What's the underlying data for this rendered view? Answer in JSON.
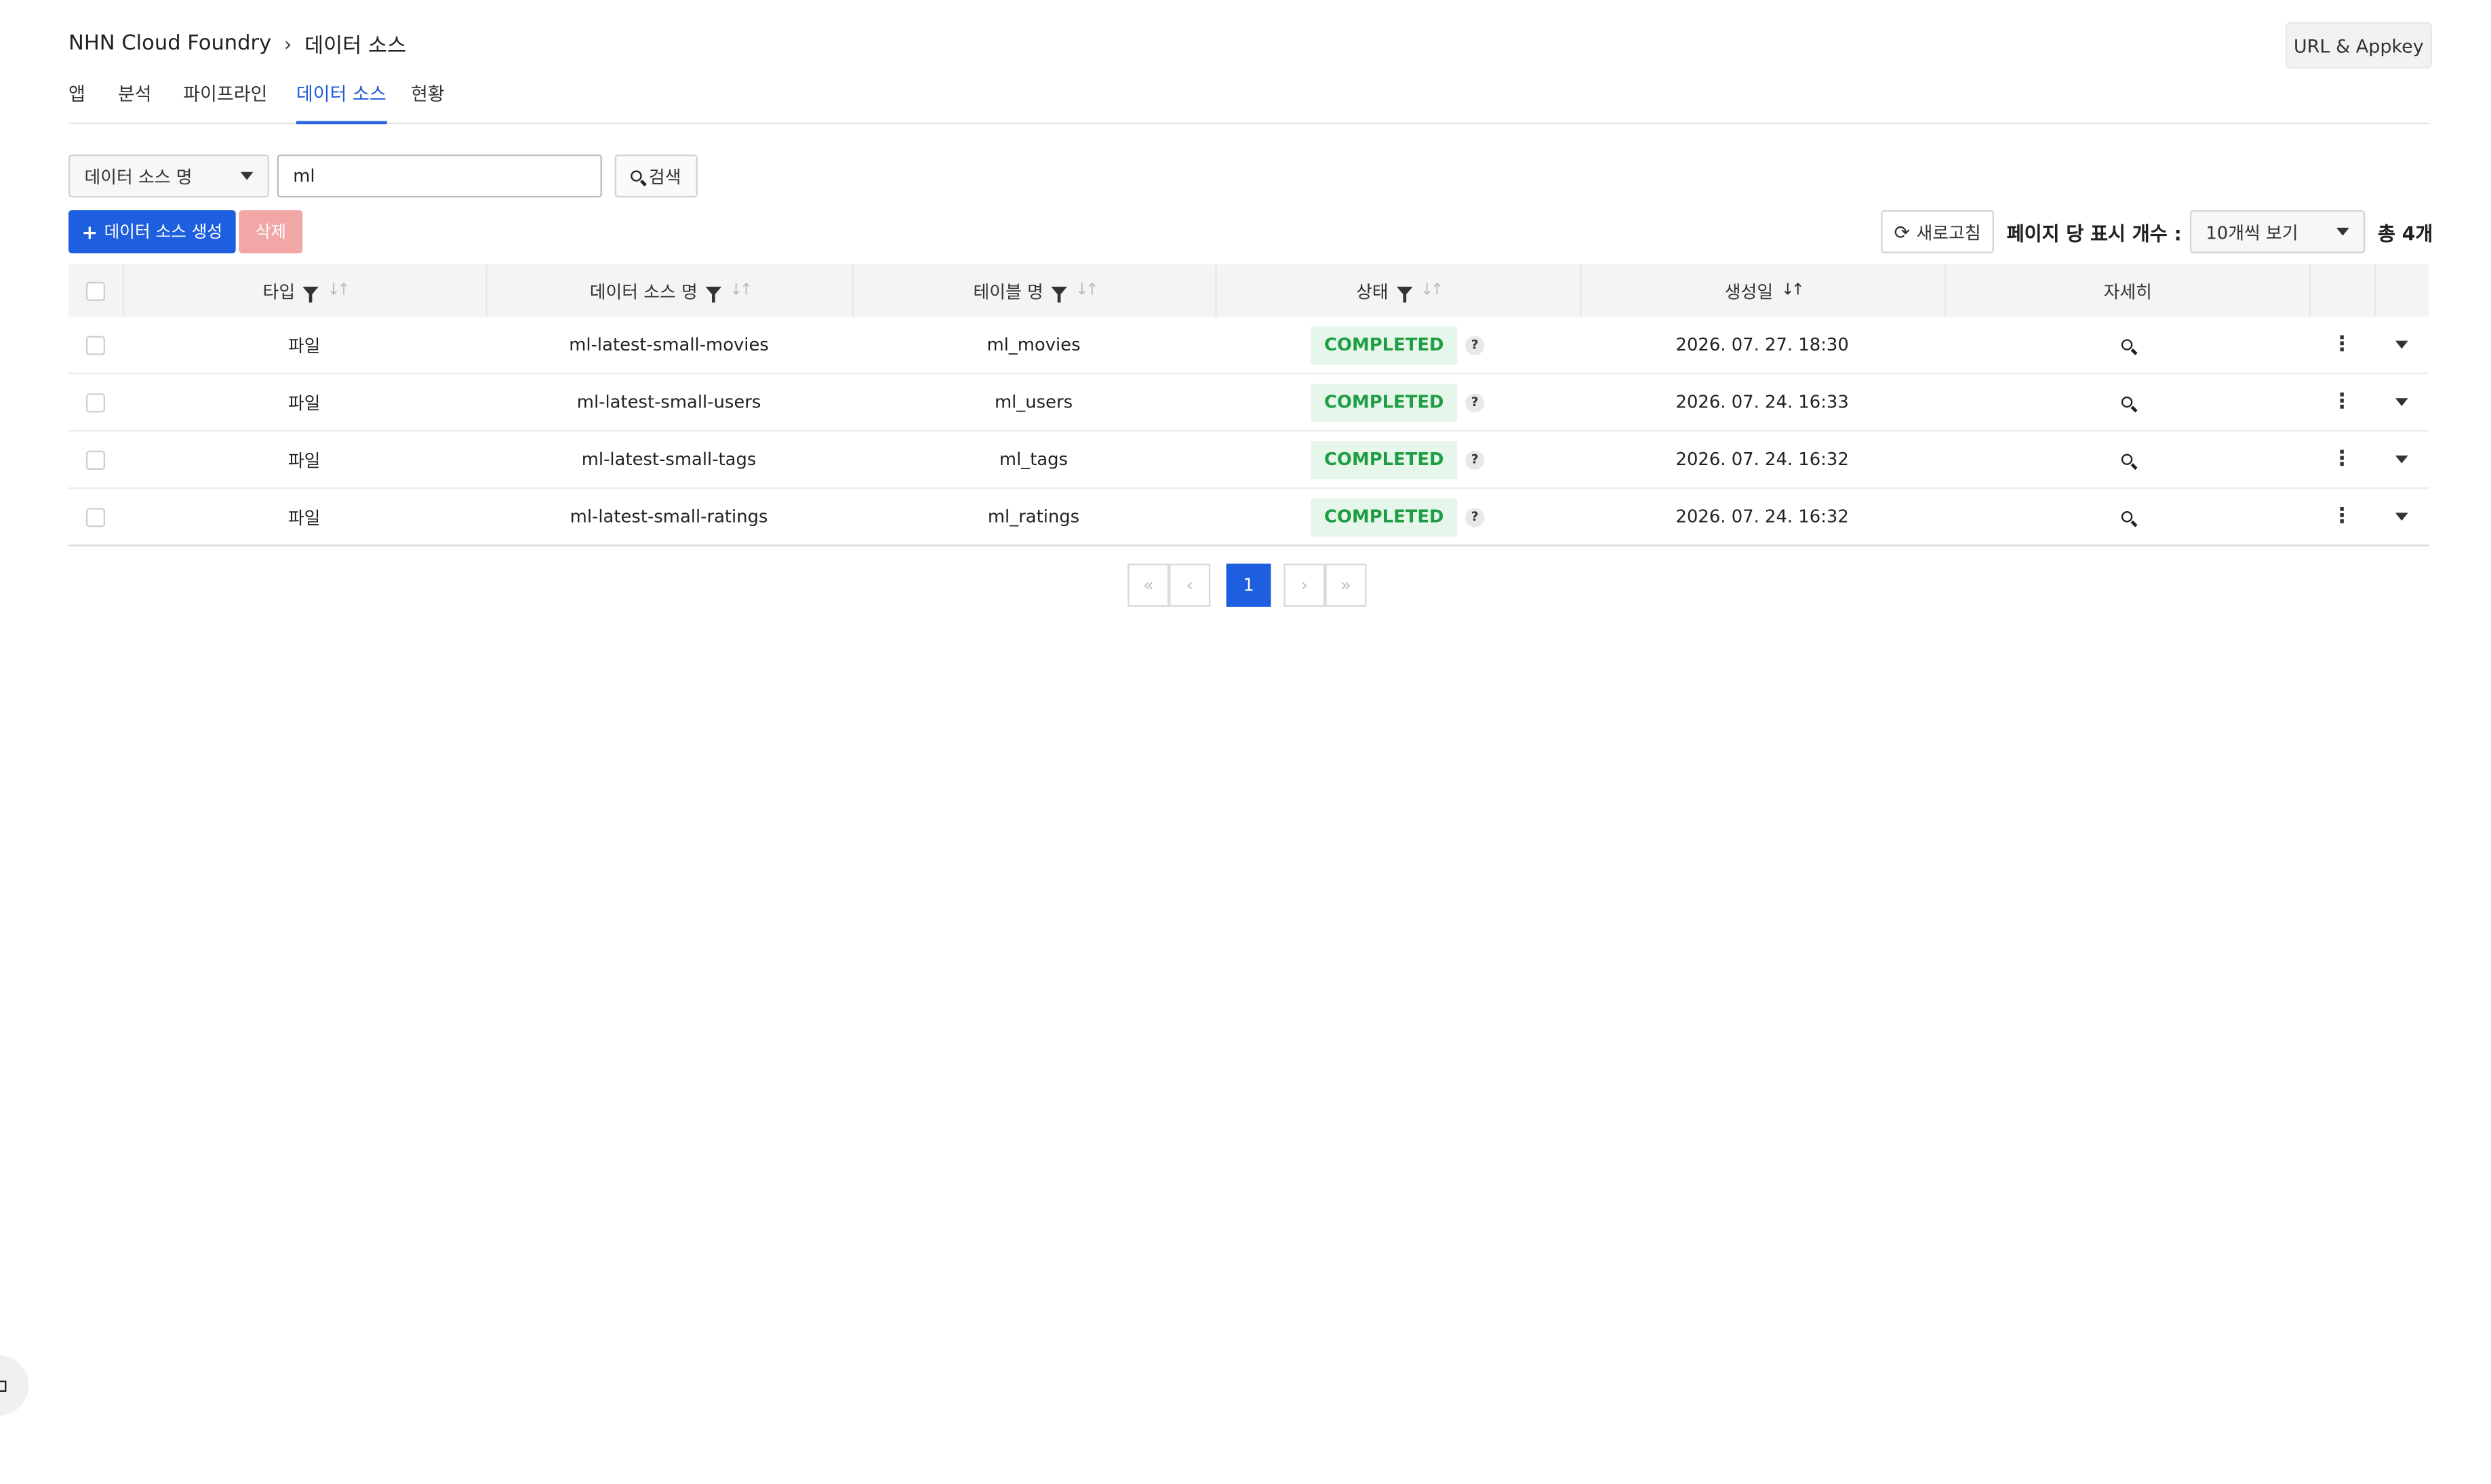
{
  "breadcrumb": {
    "root": "NHN Cloud Foundry",
    "current": "데이터 소스"
  },
  "header": {
    "url_appkey_label": "URL & Appkey"
  },
  "tabs": [
    {
      "label": "앱"
    },
    {
      "label": "분석"
    },
    {
      "label": "파이프라인"
    },
    {
      "label": "데이터 소스",
      "active": true
    },
    {
      "label": "현황"
    }
  ],
  "search": {
    "field_select": "데이터 소스 명",
    "query": "ml",
    "button_label": "검색"
  },
  "actions": {
    "create_label": "데이터 소스 생성",
    "delete_label": "삭제",
    "refresh_label": "새로고침",
    "per_page_label": "페이지 당 표시 개수 :",
    "per_page_value": "10개씩 보기",
    "total_label": "총 4개"
  },
  "table": {
    "columns": {
      "type": "타입",
      "name": "데이터 소스 명",
      "table_name": "테이블 명",
      "status": "상태",
      "created": "생성일",
      "detail": "자세히"
    },
    "rows": [
      {
        "type": "파일",
        "name": "ml-latest-small-movies",
        "table_name": "ml_movies",
        "status": "COMPLETED",
        "created": "2026. 07. 27. 18:30"
      },
      {
        "type": "파일",
        "name": "ml-latest-small-users",
        "table_name": "ml_users",
        "status": "COMPLETED",
        "created": "2026. 07. 24. 16:33"
      },
      {
        "type": "파일",
        "name": "ml-latest-small-tags",
        "table_name": "ml_tags",
        "status": "COMPLETED",
        "created": "2026. 07. 24. 16:32"
      },
      {
        "type": "파일",
        "name": "ml-latest-small-ratings",
        "table_name": "ml_ratings",
        "status": "COMPLETED",
        "created": "2026. 07. 24. 16:32"
      }
    ]
  },
  "pagination": {
    "current_page": "1"
  },
  "colors": {
    "accent": "#1d5fde",
    "status_bg": "#e7f6ea",
    "status_text": "#1e9e44",
    "delete_disabled": "#f2a7a7"
  }
}
